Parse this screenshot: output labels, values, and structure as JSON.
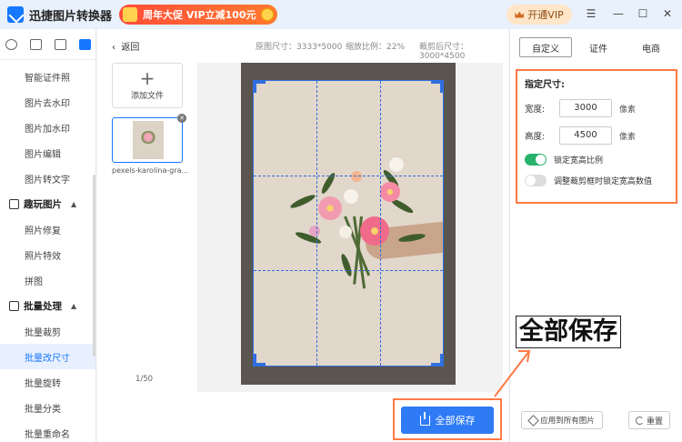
{
  "titlebar": {
    "app_title": "迅捷图片转换器",
    "promo_text": "周年大促 VIP立减100元",
    "vip_button": "开通VIP"
  },
  "sidebar": {
    "items_top": [
      "智能证件照",
      "图片去水印",
      "图片加水印",
      "图片编辑",
      "图片转文字"
    ],
    "section_fun": "趣玩图片",
    "items_fun": [
      "照片修复",
      "照片特效",
      "拼图"
    ],
    "section_batch": "批量处理",
    "items_batch": [
      "批量裁剪",
      "批量改尺寸",
      "批量旋转",
      "批量分类",
      "批量重命名"
    ]
  },
  "main": {
    "back_label": "返回",
    "original_size": "原图尺寸：3333*5000",
    "scale_ratio": "缩放比例：22%",
    "cropped_size": "裁剪后尺寸：3000*4500",
    "add_file_label": "添加文件",
    "file_name": "pexels-karolina-gra...",
    "page_indicator": "1/50",
    "save_all_label": "全部保存"
  },
  "right_panel": {
    "tabs": [
      "自定义",
      "证件",
      "电商"
    ],
    "size_title": "指定尺寸:",
    "width_label": "宽度:",
    "width_value": "3000",
    "height_label": "高度:",
    "height_value": "4500",
    "unit": "像素",
    "lock_ratio_label": "锁定宽高比例",
    "lock_ratio_on": true,
    "lock_values_label": "调整裁剪框时锁定宽高数值",
    "lock_values_on": false,
    "apply_all_label": "应用到所有图片",
    "reset_label": "重置"
  },
  "annotation": {
    "callout_text": "全部保存"
  },
  "colors": {
    "accent": "#2f7bf5",
    "highlight_border": "#ff7a45",
    "switch_on": "#27b36b"
  }
}
